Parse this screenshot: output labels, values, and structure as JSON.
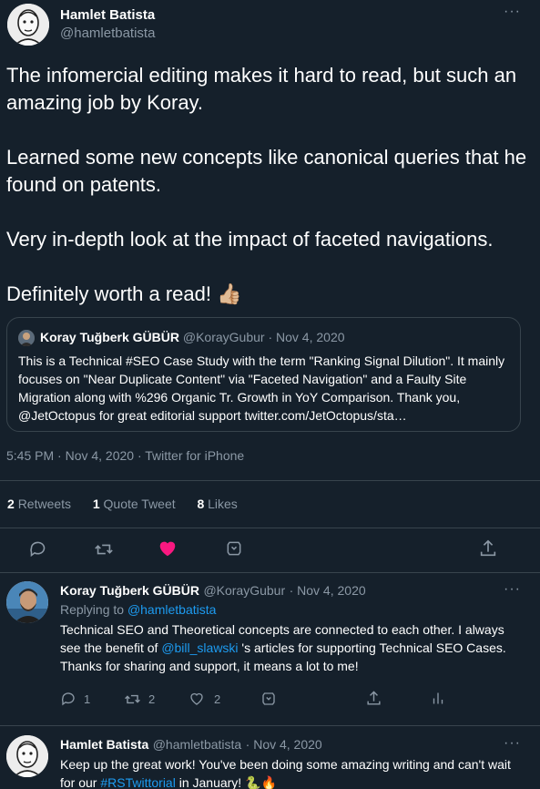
{
  "main_tweet": {
    "author_name": "Hamlet Batista",
    "author_handle": "@hamletbatista",
    "paragraphs": [
      "The infomercial editing makes it hard to read, but such an amazing job by Koray.",
      "Learned some new concepts like canonical queries that he found on patents.",
      "Very in-depth look at the impact of faceted navigations.",
      "Definitely worth a read!"
    ],
    "emoji": "👍🏼",
    "quote": {
      "author_name": "Koray Tuğberk GÜBÜR",
      "author_handle": "@KorayGubur",
      "date": "· Nov 4, 2020",
      "text": "This is a Technical #SEO Case Study with the term \"Ranking Signal Dilution\". It mainly focuses on \"Near Duplicate Content\" via \"Faceted Navigation\" and a Faulty Site Migration along with %296 Organic Tr. Growth in YoY Comparison. Thank you, @JetOctopus for great editorial support twitter.com/JetOctopus/sta…"
    },
    "timestamp": "5:45 PM · Nov 4, 2020 · Twitter for iPhone",
    "stats": {
      "retweets_count": "2",
      "retweets_label": "Retweets",
      "quotes_count": "1",
      "quotes_label": "Quote Tweet",
      "likes_count": "8",
      "likes_label": "Likes"
    },
    "liked_color": "#f91880"
  },
  "replies": [
    {
      "author_name": "Koray Tuğberk GÜBÜR",
      "author_handle": "@KorayGubur",
      "date": "· Nov 4, 2020",
      "replying_to_label": "Replying to",
      "replying_to_handle": "@hamletbatista",
      "text_1": "Technical SEO and Theoretical concepts are connected to each other. I always see the benefit of ",
      "mention": "@bill_slawski",
      "text_2": " 's articles for supporting Technical SEO Cases. Thanks for sharing and support, it means a lot to me!",
      "reply_count": "1",
      "retweet_count": "2",
      "like_count": "2"
    },
    {
      "author_name": "Hamlet Batista",
      "author_handle": "@hamletbatista",
      "date": "· Nov 4, 2020",
      "text_1": "Keep up the great work! You've been doing some amazing writing and can't wait for our ",
      "hashtag": "#RSTwittorial",
      "text_2": " in January! ",
      "emoji": "🐍🔥"
    }
  ],
  "icons": {
    "more": "more-icon",
    "reply": "reply-icon",
    "retweet": "retweet-icon",
    "like": "heart-icon",
    "bookmark": "bookmark-icon",
    "share": "share-icon",
    "analytics": "analytics-icon"
  },
  "colors": {
    "background": "#15202b",
    "link": "#1d9bf0",
    "muted": "#8b98a5",
    "border": "#38444d"
  }
}
